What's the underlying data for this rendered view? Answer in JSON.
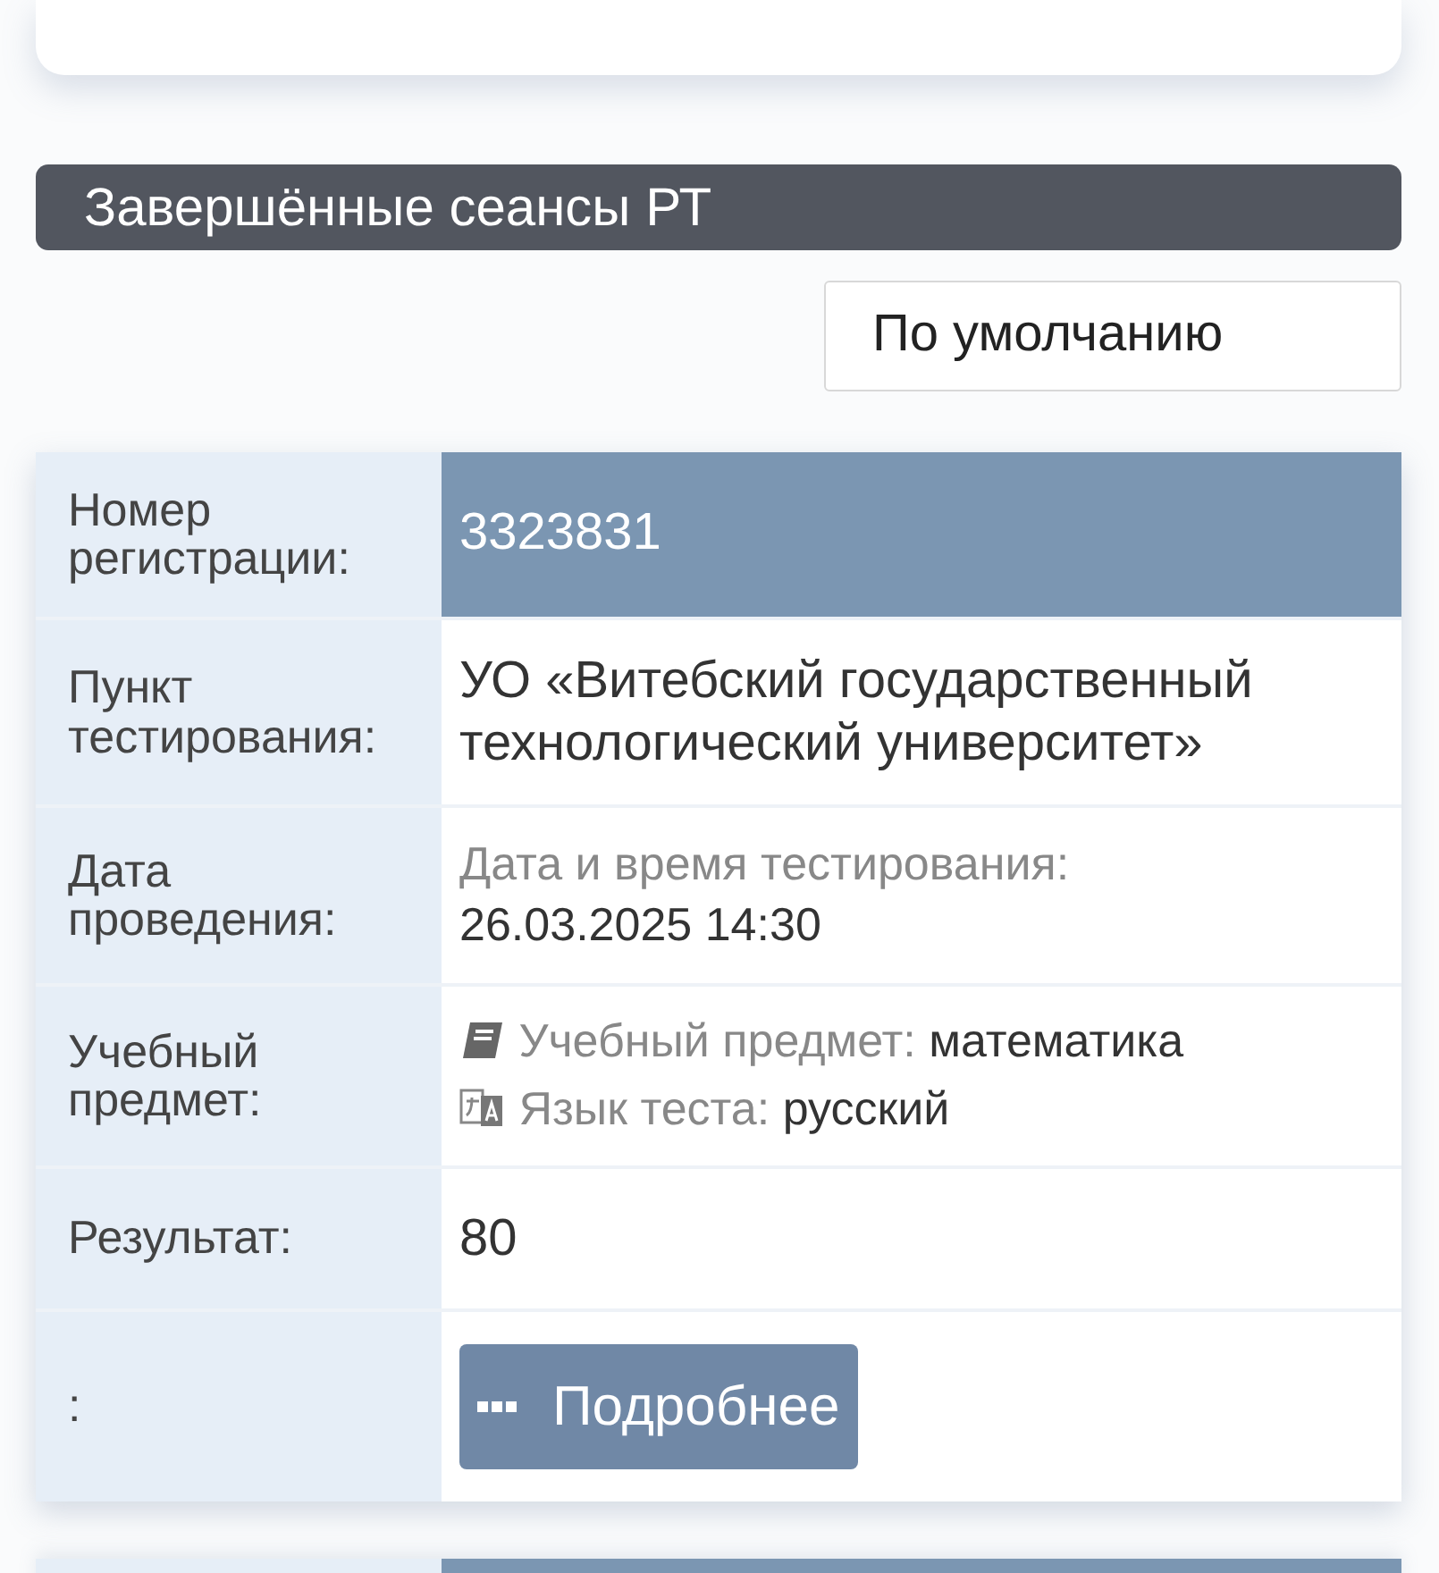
{
  "section_title": "Завершённые сеансы РТ",
  "sort_button": "По умолчанию",
  "rows": [
    {
      "kind": "highlight",
      "label": "Номер регистрации:",
      "value": "3323831"
    },
    {
      "kind": "text",
      "label": "Пункт тестирования:",
      "value": "УО «Витебский государственный технологический университет»"
    },
    {
      "kind": "pairs",
      "label": "Дата проведения:",
      "items": [
        {
          "kind": "plain",
          "caption": "Дата и время тестирования:",
          "value": "26.03.2025 14:30"
        }
      ]
    },
    {
      "kind": "pairs",
      "label": "Учебный предмет:",
      "items": [
        {
          "kind": "subject",
          "caption": "Учебный предмет:",
          "value": "математика"
        },
        {
          "kind": "language",
          "caption": "Язык теста:",
          "value": "русский"
        }
      ]
    },
    {
      "kind": "text",
      "label": "Результат:",
      "value": "80"
    },
    {
      "kind": "action",
      "label": ":",
      "value": "Подробнее"
    }
  ]
}
